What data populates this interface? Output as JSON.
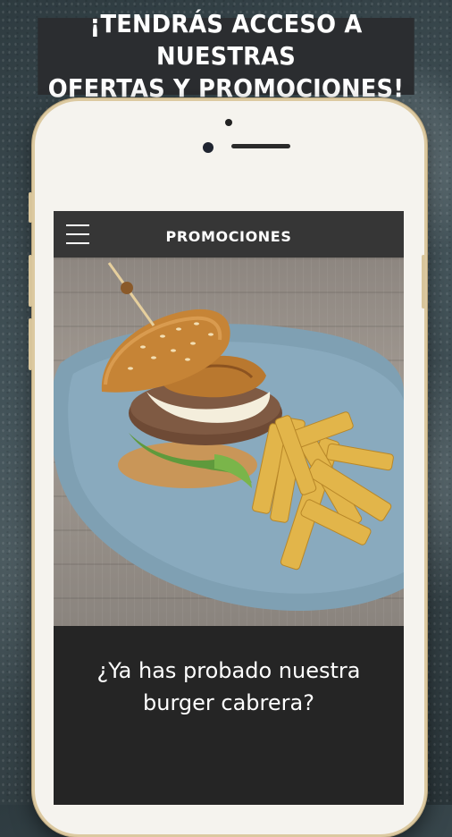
{
  "banner": {
    "line1": "¡TENDRÁS ACCESO A NUESTRAS",
    "line2": "OFERTAS Y PROMOCIONES!"
  },
  "appbar": {
    "title": "PROMOCIONES",
    "menu_icon": "hamburger-menu-icon"
  },
  "promo": {
    "image_alt": "burger-with-fries",
    "caption": "¿Ya has probado nuestra burger cabrera?"
  },
  "colors": {
    "banner_bg": "#2b2d30",
    "appbar_bg": "#363636",
    "caption_bg": "#252525",
    "phone_frame": "#f5f3ee",
    "phone_trim": "#dcc9a0"
  }
}
